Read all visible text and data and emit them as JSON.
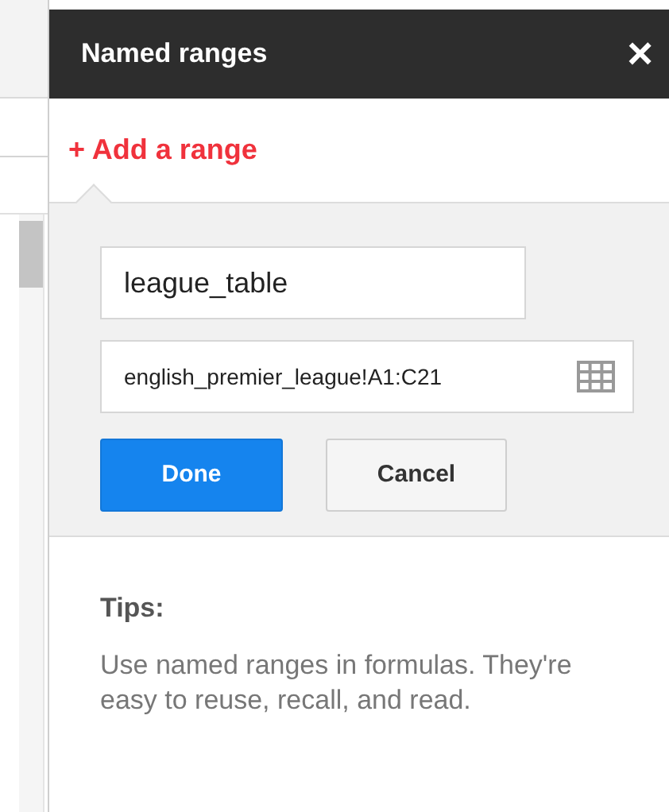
{
  "panel": {
    "title": "Named ranges",
    "close": "×"
  },
  "add_range": "+ Add a range",
  "form": {
    "name_value": "league_table",
    "range_value": "english_premier_league!A1:C21"
  },
  "buttons": [
    {
      "label": "Done",
      "kind": "primary"
    },
    {
      "label": "Cancel",
      "kind": "secondary"
    }
  ],
  "tips": {
    "title": "Tips:",
    "text": "Use named ranges in formulas. They're easy to reuse, recall, and read."
  }
}
